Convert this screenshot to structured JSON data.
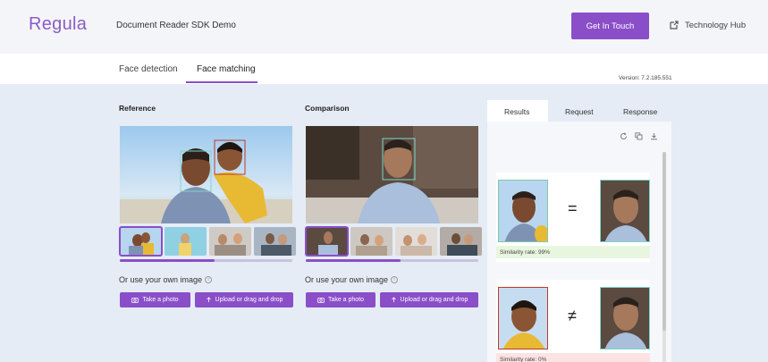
{
  "header": {
    "logo": "Regula",
    "app_title": "Document Reader SDK Demo",
    "cta_label": "Get In Touch",
    "tech_hub_label": "Technology Hub"
  },
  "tabs": [
    {
      "label": "Face detection",
      "active": false
    },
    {
      "label": "Face matching",
      "active": true
    }
  ],
  "version": "Version: 7.2.185.551",
  "reference": {
    "title": "Reference",
    "own_image_label": "Or use your own image",
    "take_photo_label": "Take a photo",
    "upload_label": "Upload or drag and drop",
    "scroll_fraction": 0.55
  },
  "comparison": {
    "title": "Comparison",
    "own_image_label": "Or use your own image",
    "take_photo_label": "Take a photo",
    "upload_label": "Upload or drag and drop",
    "scroll_fraction": 0.55
  },
  "panel": {
    "tabs": [
      "Results",
      "Request",
      "Response"
    ],
    "active_tab": "Results",
    "results": [
      {
        "symbol": "=",
        "similarity_label": "Similarity rate: 99%",
        "status_color": "#e9f6df"
      },
      {
        "symbol": "≠",
        "similarity_label": "Similarity rate: 0%",
        "status_color": "#fbe3e3"
      }
    ]
  },
  "colors": {
    "accent": "#8a4fc8",
    "match_border": "#7ec8a8",
    "mismatch_border": "#c0392b",
    "face_box": "#7fd6c9"
  },
  "icons": [
    "external-link-icon",
    "camera-icon",
    "upload-icon",
    "refresh-icon",
    "copy-icon",
    "download-icon",
    "info-icon"
  ]
}
